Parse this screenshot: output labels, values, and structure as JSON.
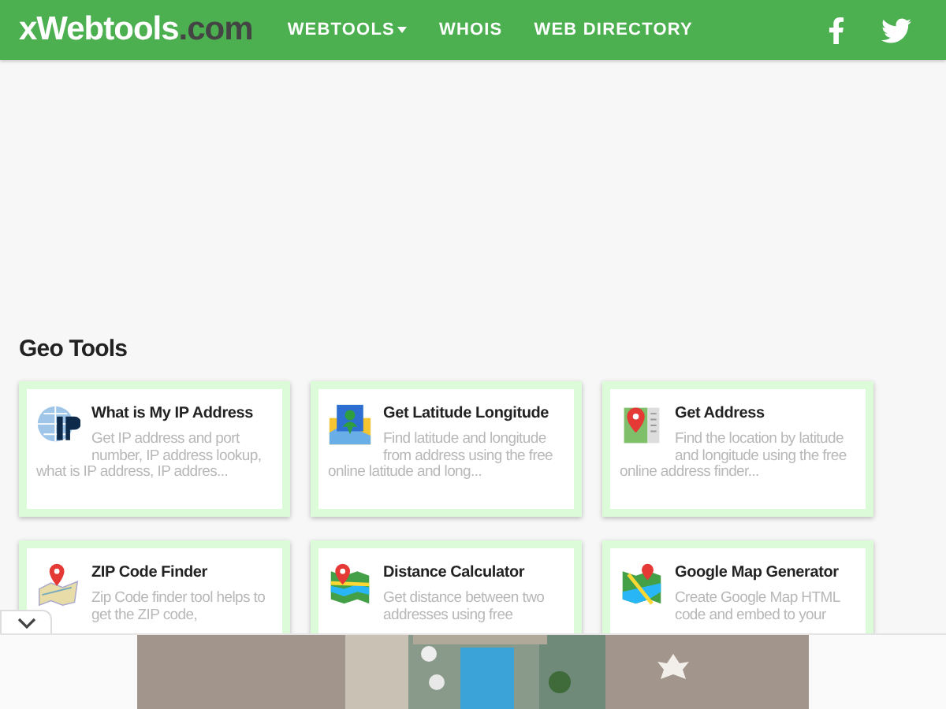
{
  "header": {
    "logo": {
      "name": "xWebtools",
      "tld": ".com"
    },
    "nav": [
      {
        "label": "WEBTOOLS",
        "dropdown": true
      },
      {
        "label": "WHOIS",
        "dropdown": false
      },
      {
        "label": "WEB DIRECTORY",
        "dropdown": false
      }
    ]
  },
  "section": {
    "title": "Geo Tools",
    "tools": [
      {
        "kind": "ip",
        "title": "What is My IP Address",
        "description": "Get IP address and port number, IP address lookup, what is IP address, IP addres..."
      },
      {
        "kind": "latlng",
        "title": "Get Latitude Longitude",
        "description": "Find latitude and longitude from address using the free online latitude and long..."
      },
      {
        "kind": "address",
        "title": "Get Address",
        "description": "Find the location by latitude and longitude using the free online address finder..."
      },
      {
        "kind": "zip",
        "title": "ZIP Code Finder",
        "description": "Zip Code finder tool helps to get the ZIP code,"
      },
      {
        "kind": "distance",
        "title": "Distance Calculator",
        "description": "Get distance between two addresses using free"
      },
      {
        "kind": "mapgen",
        "title": "Google Map Generator",
        "description": "Create Google Map HTML code and embed to your"
      }
    ]
  }
}
